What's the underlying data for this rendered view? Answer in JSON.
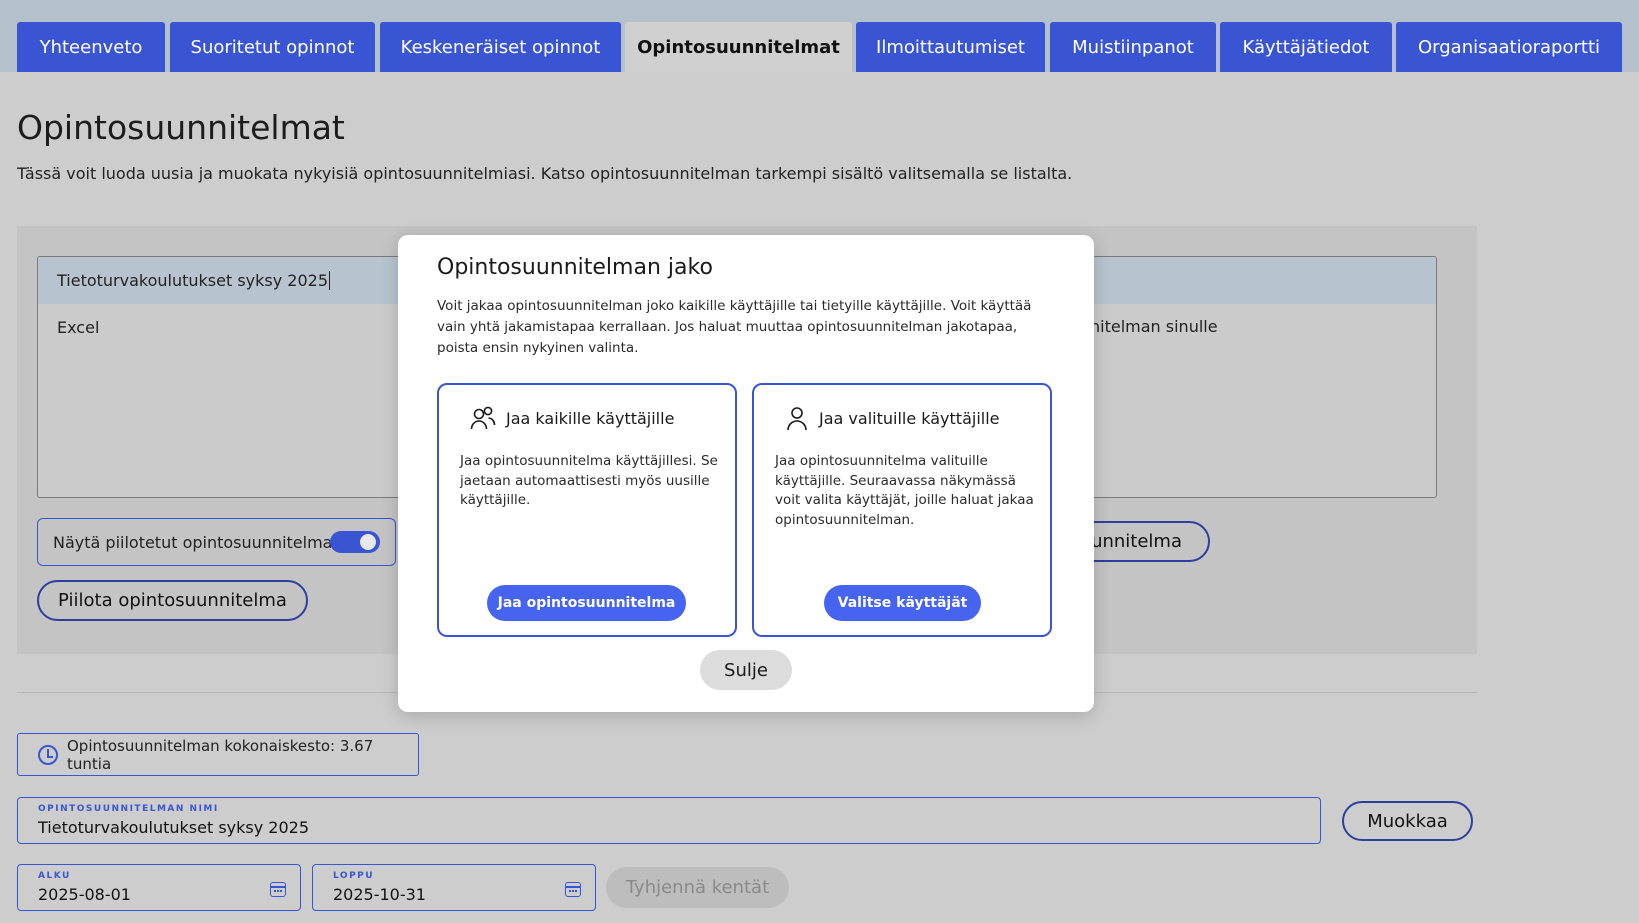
{
  "tabs": [
    {
      "label": "Yhteenveto"
    },
    {
      "label": "Suoritetut opinnot"
    },
    {
      "label": "Keskeneräiset opinnot"
    },
    {
      "label": "Opintosuunnitelmat"
    },
    {
      "label": "Ilmoittautumiset"
    },
    {
      "label": "Muistiinpanot"
    },
    {
      "label": "Käyttäjätiedot"
    },
    {
      "label": "Organisaatioraportti"
    }
  ],
  "active_tab": "Opintosuunnitelmat",
  "page": {
    "title": "Opintosuunnitelmat",
    "intro": "Tässä voit luoda uusia ja muokata nykyisiä opintosuunnitelmiasi. Katso opintosuunnitelman tarkempi sisältö valitsemalla se listalta."
  },
  "plans_list": {
    "items": [
      "Tietoturvakoulutukset syksy 2025",
      "Excel"
    ],
    "selected": "Tietoturvakoulutukset syksy 2025",
    "partial_right_text": "nitelman sinulle"
  },
  "controls": {
    "show_hidden_label": "Näytä piilotetut opintosuunnitelmat",
    "show_hidden_on": true,
    "hide_plan_button": "Piilota opintosuunnitelma",
    "partial_button": "uunnitelma"
  },
  "details": {
    "duration": "Opintosuunnitelman kokonaiskesto: 3.67 tuntia",
    "name_label": "OPINTOSUUNNITELMAN NIMI",
    "name_value": "Tietoturvakoulutukset syksy 2025",
    "edit_button": "Muokkaa",
    "start_label": "ALKU",
    "start_value": "2025-08-01",
    "end_label": "LOPPU",
    "end_value": "2025-10-31",
    "clear_button": "Tyhjennä kentät"
  },
  "modal": {
    "title": "Opintosuunnitelman jako",
    "description": "Voit jakaa opintosuunnitelman joko kaikille käyttäjille tai tietyille käyttäjille. Voit käyttää vain yhtä jakamistapaa kerrallaan. Jos haluat muuttaa opintosuunnitelman jakotapaa, poista ensin nykyinen valinta.",
    "share_all": {
      "icon": "users-icon",
      "title": "Jaa kaikille käyttäjille",
      "body": "Jaa opintosuunnitelma käyttäjillesi. Se jaetaan automaattisesti myös uusille käyttäjille.",
      "button": "Jaa opintosuunnitelma"
    },
    "share_selected": {
      "icon": "user-icon",
      "title": "Jaa valituille käyttäjille",
      "body": "Jaa opintosuunnitelma valituille käyttäjille. Seuraavassa näkymässä voit valita käyttäjät, joille haluat jakaa opintosuunnitelman.",
      "button": "Valitse käyttäjät"
    },
    "close_button": "Sulje"
  },
  "colors": {
    "accent": "#3a55d3",
    "primary_button": "#4664f0",
    "background": "#cdcdcd"
  }
}
